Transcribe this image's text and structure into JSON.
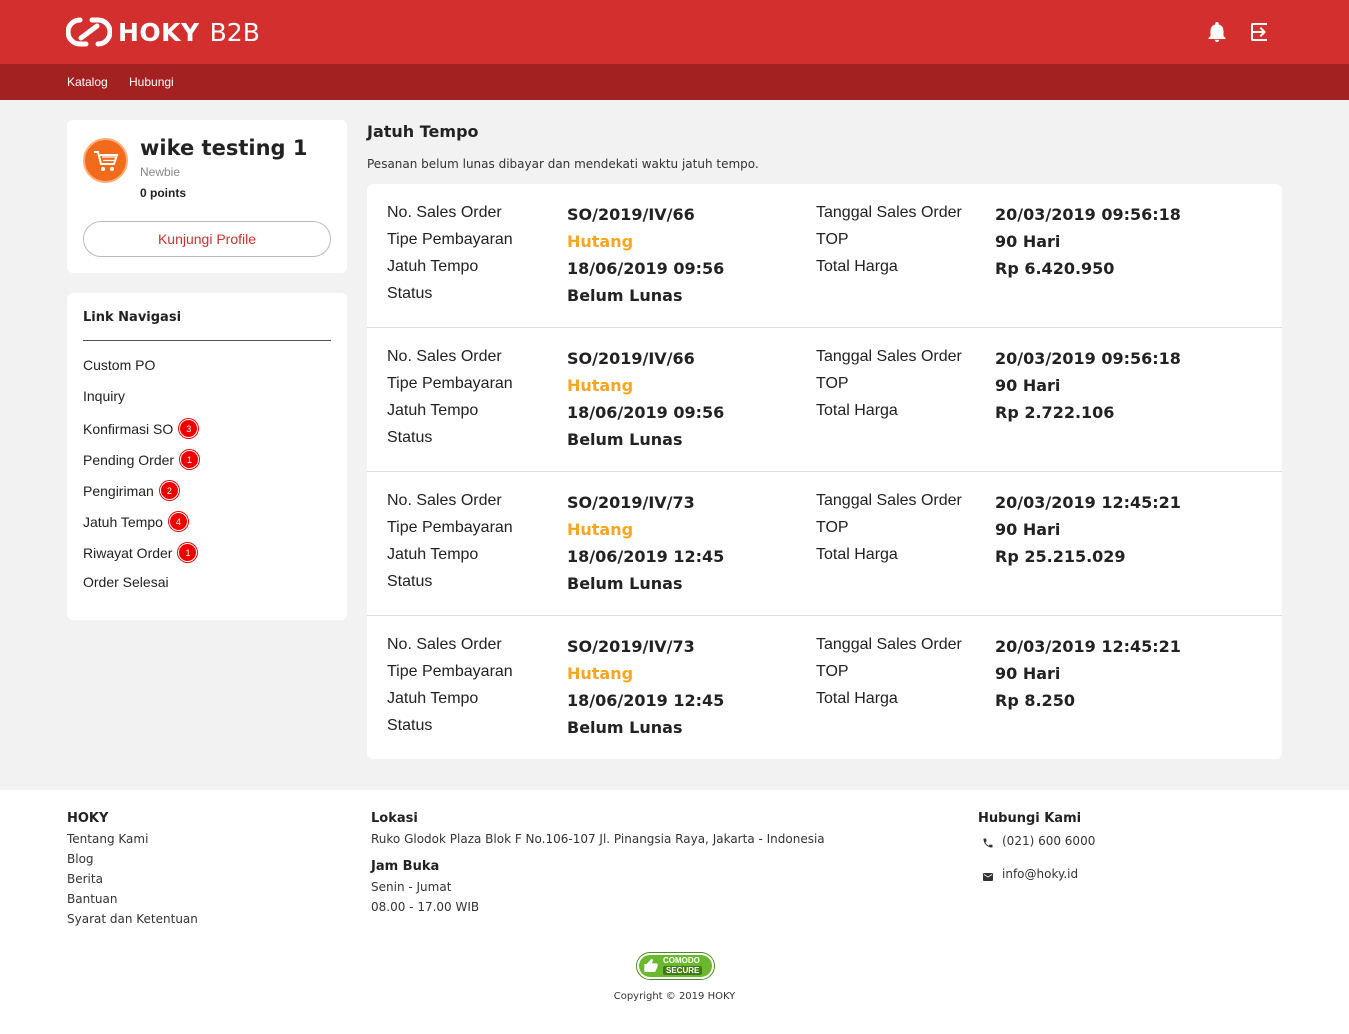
{
  "app": {
    "brand": "HOKY",
    "brand_suffix": "B2B"
  },
  "topbar": {
    "icons": [
      "bell-icon",
      "logout-icon"
    ]
  },
  "nav": {
    "items": [
      "Katalog",
      "Hubungi"
    ]
  },
  "profile": {
    "name": "wike testing 1",
    "level": "Newbie",
    "points": "0 points",
    "button": "Kunjungi Profile"
  },
  "sidenav": {
    "title": "Link Navigasi",
    "items": [
      {
        "label": "Custom PO",
        "badge": ""
      },
      {
        "label": "Inquiry",
        "badge": ""
      },
      {
        "label": "Konfirmasi SO",
        "badge": "3"
      },
      {
        "label": "Pending Order",
        "badge": "1"
      },
      {
        "label": "Pengiriman",
        "badge": "2"
      },
      {
        "label": "Jatuh Tempo",
        "badge": "4"
      },
      {
        "label": "Riwayat Order",
        "badge": "1"
      },
      {
        "label": "Order Selesai",
        "badge": ""
      }
    ]
  },
  "main": {
    "title": "Jatuh Tempo",
    "description": "Pesanan belum lunas dibayar dan mendekati waktu jatuh tempo.",
    "labels": {
      "so": "No. Sales Order",
      "payment": "Tipe Pembayaran",
      "due": "Jatuh Tempo",
      "status": "Status",
      "so_date": "Tanggal Sales Order",
      "top": "TOP",
      "total": "Total Harga"
    },
    "orders": [
      {
        "so": "SO/2019/IV/66",
        "payment": "Hutang",
        "due": "18/06/2019 09:56",
        "status": "Belum Lunas",
        "so_date": "20/03/2019 09:56:18",
        "top": "90 Hari",
        "total": "Rp 6.420.950"
      },
      {
        "so": "SO/2019/IV/66",
        "payment": "Hutang",
        "due": "18/06/2019 09:56",
        "status": "Belum Lunas",
        "so_date": "20/03/2019 09:56:18",
        "top": "90 Hari",
        "total": "Rp 2.722.106"
      },
      {
        "so": "SO/2019/IV/73",
        "payment": "Hutang",
        "due": "18/06/2019 12:45",
        "status": "Belum Lunas",
        "so_date": "20/03/2019 12:45:21",
        "top": "90 Hari",
        "total": "Rp 25.215.029"
      },
      {
        "so": "SO/2019/IV/73",
        "payment": "Hutang",
        "due": "18/06/2019 12:45",
        "status": "Belum Lunas",
        "so_date": "20/03/2019 12:45:21",
        "top": "90 Hari",
        "total": "Rp 8.250"
      }
    ]
  },
  "footer": {
    "col1": {
      "title": "HOKY",
      "links": [
        "Tentang Kami",
        "Blog",
        "Berita",
        "Bantuan",
        "Syarat dan Ketentuan"
      ]
    },
    "col2": {
      "title": "Lokasi",
      "address": "Ruko Glodok Plaza Blok F No.106-107 Jl. Pinangsia Raya, Jakarta - Indonesia",
      "hours_title": "Jam Buka",
      "days": "Senin - Jumat",
      "hours": "08.00 - 17.00 WIB"
    },
    "col3": {
      "title": "Hubungi Kami",
      "phone": "(021) 600 6000",
      "email": "info@hoky.id"
    },
    "badge": {
      "line1": "COMODO",
      "line2": "SECURE"
    },
    "copyright": "Copyright © 2019 HOKY"
  },
  "colors": {
    "primary": "#d32f2f",
    "nav": "#a32121",
    "accent": "#f5a623",
    "badge": "#ee0000"
  }
}
